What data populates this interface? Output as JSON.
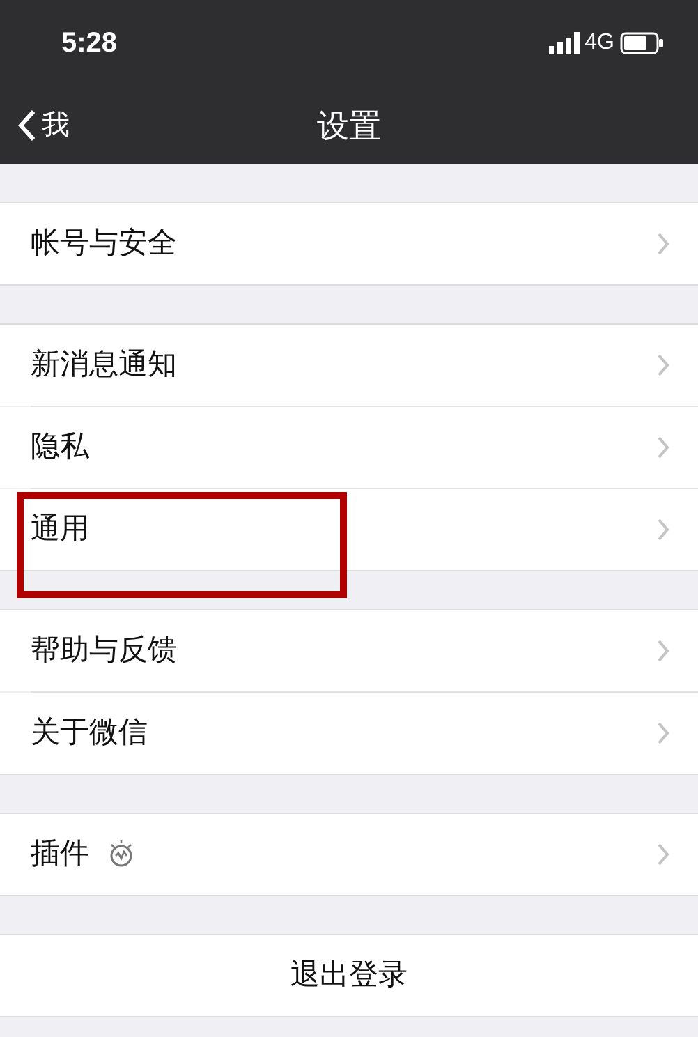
{
  "status_bar": {
    "time": "5:28",
    "network": "4G"
  },
  "nav": {
    "back": "我",
    "title": "设置"
  },
  "groups": [
    {
      "items": [
        {
          "label": "帐号与安全",
          "highlighted": false,
          "kind": "plain"
        }
      ]
    },
    {
      "items": [
        {
          "label": "新消息通知",
          "highlighted": false,
          "kind": "plain"
        },
        {
          "label": "隐私",
          "highlighted": false,
          "kind": "plain"
        },
        {
          "label": "通用",
          "highlighted": true,
          "kind": "plain"
        }
      ]
    },
    {
      "items": [
        {
          "label": "帮助与反馈",
          "highlighted": false,
          "kind": "plain"
        },
        {
          "label": "关于微信",
          "highlighted": false,
          "kind": "plain"
        }
      ]
    },
    {
      "items": [
        {
          "label": "插件",
          "highlighted": false,
          "kind": "plugin"
        }
      ]
    }
  ],
  "logout": "退出登录"
}
